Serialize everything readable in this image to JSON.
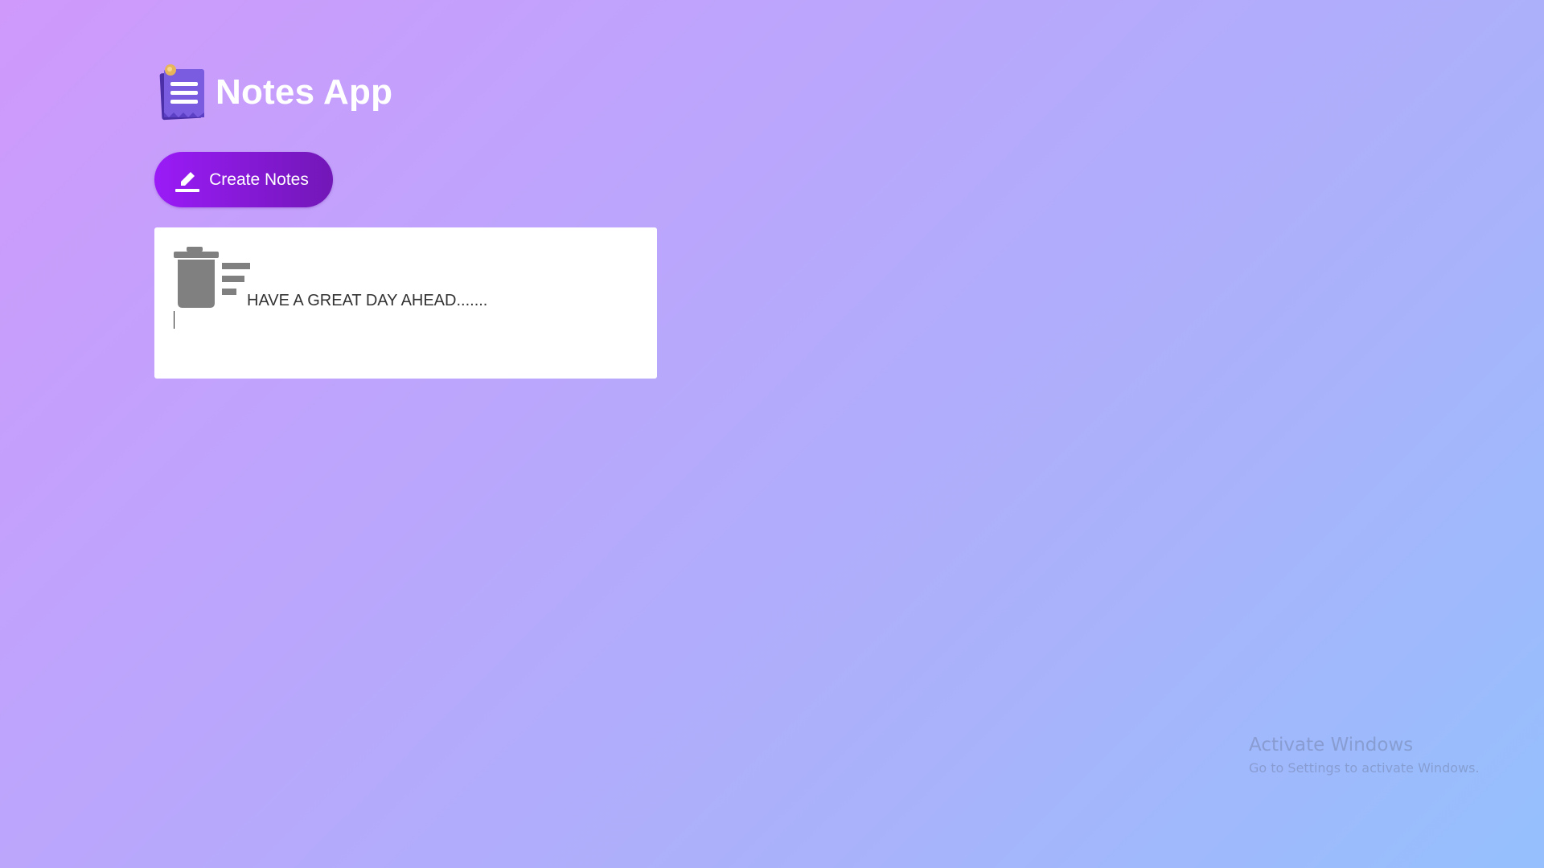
{
  "app": {
    "title": "Notes App",
    "logo_icon": "notepad-icon"
  },
  "toolbar": {
    "create_label": "Create Notes",
    "create_icon": "pencil-icon"
  },
  "notes": [
    {
      "text": "HAVE A GREAT DAY AHEAD.......",
      "delete_icon": "trash-icon",
      "edit_icon": "list-edit-icon"
    }
  ],
  "watermark": {
    "title": "Activate Windows",
    "subtitle": "Go to Settings to activate Windows."
  },
  "colors": {
    "background_start": "#cf99fb",
    "background_end": "#95c0fd",
    "button_start": "#9a1bf7",
    "button_end": "#7217b7",
    "icon_gray": "#808080"
  }
}
